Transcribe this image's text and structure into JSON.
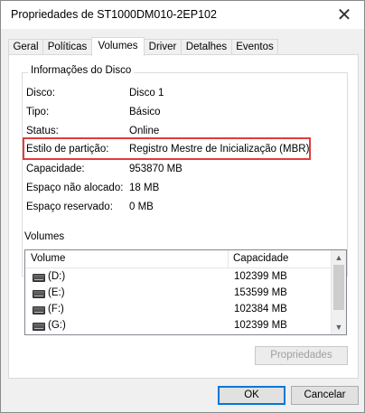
{
  "window": {
    "title": "Propriedades de ST1000DM010-2EP102",
    "close_glyph": "✕"
  },
  "tabs": [
    {
      "label": "Geral"
    },
    {
      "label": "Políticas"
    },
    {
      "label": "Volumes"
    },
    {
      "label": "Driver"
    },
    {
      "label": "Detalhes"
    },
    {
      "label": "Eventos"
    }
  ],
  "active_tab": "Volumes",
  "disk_info": {
    "legend": "Informações do Disco",
    "rows": [
      {
        "label": "Disco:",
        "value": "Disco 1"
      },
      {
        "label": "Tipo:",
        "value": "Básico"
      },
      {
        "label": "Status:",
        "value": "Online"
      },
      {
        "label": "Estilo de partição:",
        "value": "Registro Mestre de Inicialização (MBR)"
      },
      {
        "label": "Capacidade:",
        "value": "953870 MB"
      },
      {
        "label": "Espaço não alocado:",
        "value": "18 MB"
      },
      {
        "label": "Espaço reservado:",
        "value": "0 MB"
      }
    ]
  },
  "volumes": {
    "label": "Volumes",
    "columns": [
      "Volume",
      "Capacidade"
    ],
    "rows": [
      {
        "name": "(D:)",
        "capacity": "102399 MB"
      },
      {
        "name": "(E:)",
        "capacity": "153599 MB"
      },
      {
        "name": "(F:)",
        "capacity": "102384 MB"
      },
      {
        "name": "(G:)",
        "capacity": "102399 MB"
      }
    ],
    "properties_button": "Propriedades"
  },
  "footer": {
    "ok": "OK",
    "cancel": "Cancelar"
  },
  "colors": {
    "highlight": "#e23b3b",
    "accent": "#0078d7"
  }
}
